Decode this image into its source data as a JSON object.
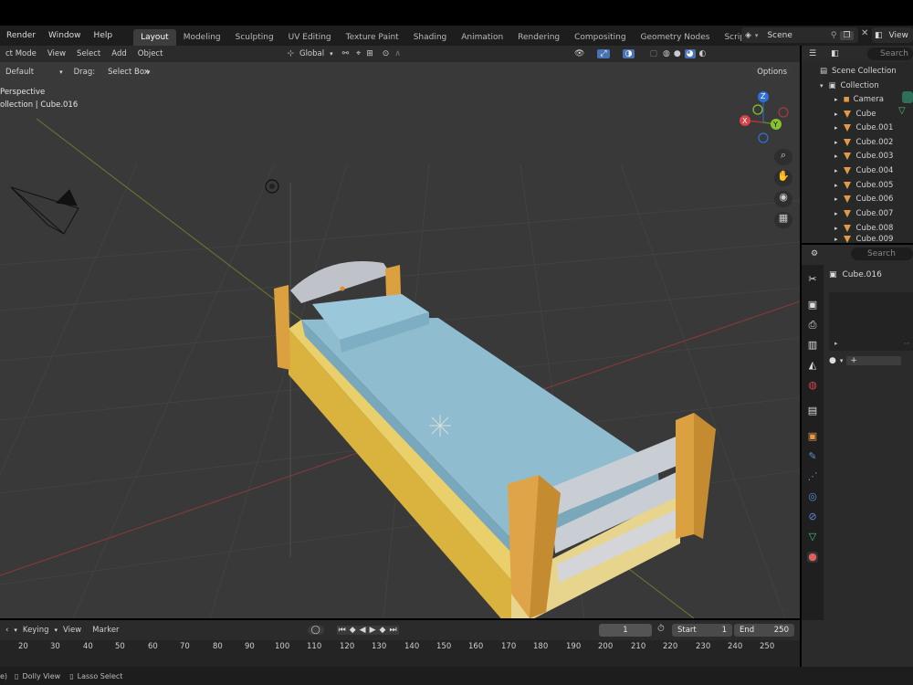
{
  "menu": {
    "items": [
      "Render",
      "Window",
      "Help"
    ]
  },
  "workspaces": [
    "Layout",
    "Modeling",
    "Sculpting",
    "UV Editing",
    "Texture Paint",
    "Shading",
    "Animation",
    "Rendering",
    "Compositing",
    "Geometry Nodes",
    "Scripting",
    "+"
  ],
  "active_workspace": "Layout",
  "scene": {
    "name": "Scene",
    "view_layer": "View"
  },
  "viewport_header": {
    "mode": "ct Mode",
    "menus": [
      "View",
      "Select",
      "Add",
      "Object"
    ],
    "transform_orientation": "Global"
  },
  "tool_header": {
    "orientation_label": "Default",
    "drag_label": "Drag:",
    "drag_value": "Select Box",
    "options_label": "Options"
  },
  "viewport_info": {
    "view_name": "Perspective",
    "collection_object": "ollection | Cube.016"
  },
  "gizmo": {
    "z": "Z",
    "y": "Y",
    "x": "X"
  },
  "outliner": {
    "search_placeholder": "Search",
    "root": "Scene Collection",
    "collection": "Collection",
    "items": [
      "Camera",
      "Cube",
      "Cube.001",
      "Cube.002",
      "Cube.003",
      "Cube.004",
      "Cube.005",
      "Cube.006",
      "Cube.007",
      "Cube.008",
      "Cube.009"
    ]
  },
  "properties": {
    "search_placeholder": "Search",
    "object_name": "Cube.016",
    "material_add": "+"
  },
  "timeline": {
    "keying": "Keying",
    "view": "View",
    "marker": "Marker",
    "current_frame": "1",
    "start_label": "Start",
    "start_value": "1",
    "end_label": "End",
    "end_value": "250",
    "ticks": [
      "20",
      "30",
      "40",
      "50",
      "60",
      "70",
      "80",
      "90",
      "100",
      "110",
      "120",
      "130",
      "140",
      "150",
      "160",
      "170",
      "180",
      "190",
      "200",
      "210",
      "220",
      "230",
      "240",
      "250"
    ]
  },
  "status_bar": {
    "first": "e)",
    "dolly": "Dolly View",
    "lasso": "Lasso Select"
  },
  "colors": {
    "bed_blue": "#8fbdcf",
    "bed_yellow": "#e3c24a",
    "bed_orange": "#dba040",
    "rail_white": "#c9cdd4",
    "accent_blue": "#4772b3"
  }
}
